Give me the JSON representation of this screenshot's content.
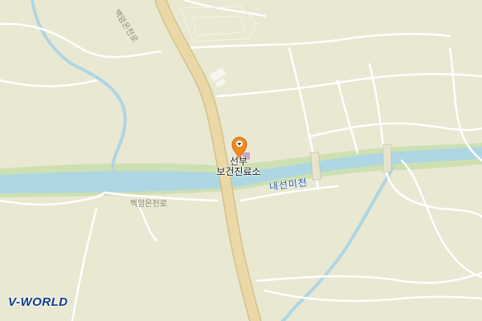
{
  "map": {
    "colors": {
      "land": "#e9e8d3",
      "river": "#aed6e3",
      "riverbank": "#cde0b2",
      "road": "#ffffff",
      "main_road": "#ead9a6",
      "main_road_edge": "#d4c189",
      "marker": "#f28a1e"
    },
    "poi": {
      "line1": "선부",
      "line2": "보건진료소",
      "icon": "map-pin-icon"
    },
    "labels": {
      "river": "내선미천",
      "road_north": "백암온천로",
      "road_south": "백암온천로"
    },
    "logo": "V-WORLD"
  }
}
